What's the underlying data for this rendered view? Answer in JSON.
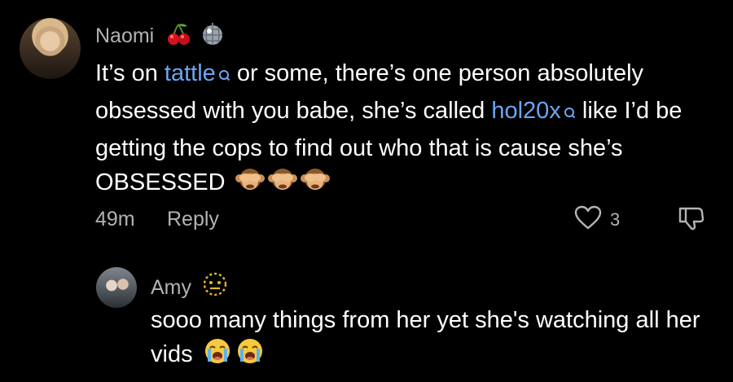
{
  "comment": {
    "author": "Naomi",
    "author_emojis": [
      "cherries-emoji",
      "disco-ball-emoji"
    ],
    "text_1": "It’s on ",
    "link_1": "tattle",
    "text_2": " or some, there’s one person absolutely obsessed with you babe, she’s called ",
    "link_2": "hol20x",
    "text_3": " like I’d be getting the cops to find out who that is cause she’s OBSESSED",
    "trailing_emojis": [
      "see-no-evil-monkey-emoji",
      "see-no-evil-monkey-emoji",
      "see-no-evil-monkey-emoji"
    ],
    "time": "49m",
    "reply_label": "Reply",
    "like_count": "3"
  },
  "reply": {
    "author": "Amy",
    "author_emoji": "dotted-face-emoji",
    "text": "sooo many things from her yet she's watching all her vids",
    "trailing_emojis": [
      "loudly-crying-face-emoji",
      "loudly-crying-face-emoji"
    ]
  },
  "colors": {
    "background": "#000000",
    "link": "#6aa6f2",
    "muted": "#b3b3b3",
    "text": "#ffffff"
  }
}
